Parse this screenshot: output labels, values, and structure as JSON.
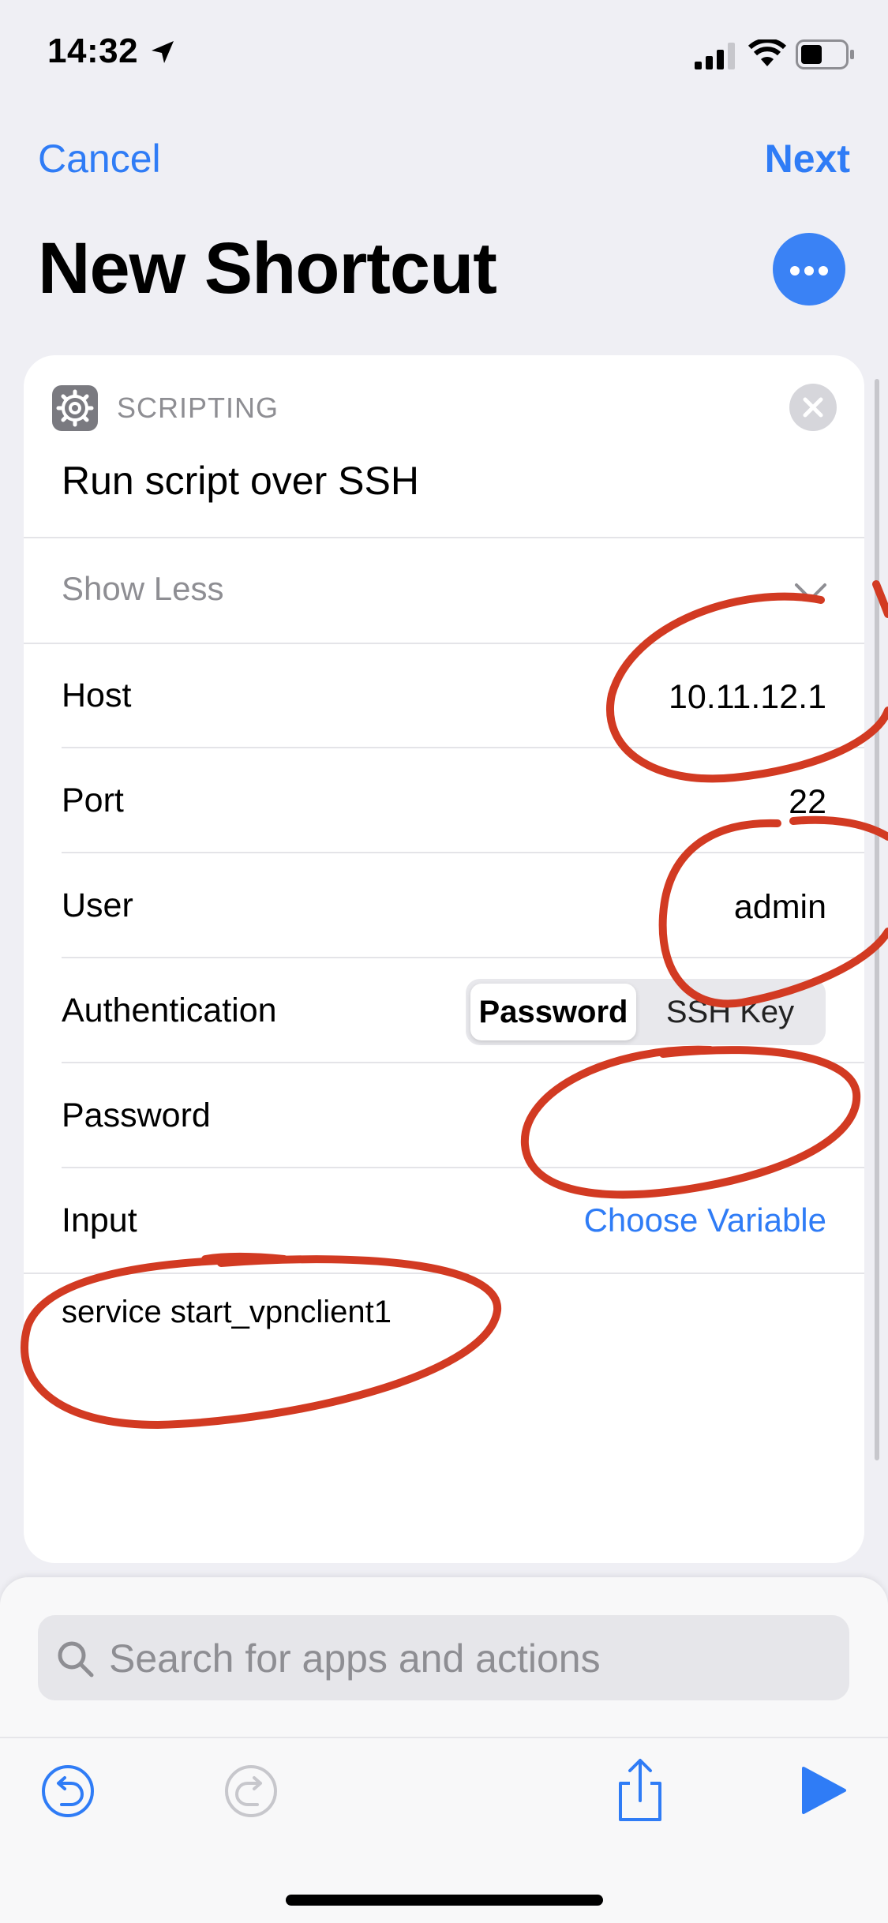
{
  "status_bar": {
    "time": "14:32"
  },
  "nav": {
    "cancel": "Cancel",
    "next": "Next",
    "title": "New Shortcut"
  },
  "card": {
    "category": "SCRIPTING",
    "action_title": "Run script over SSH",
    "show_less": "Show Less",
    "rows": [
      {
        "label": "Host",
        "value": "10.11.12.1"
      },
      {
        "label": "Port",
        "value": "22"
      },
      {
        "label": "User",
        "value": "admin"
      },
      {
        "label": "Authentication"
      },
      {
        "label": "Password",
        "value": ""
      },
      {
        "label": "Input",
        "value": "Choose Variable"
      }
    ],
    "auth_options": [
      "Password",
      "SSH Key"
    ],
    "auth_selected": "Password",
    "script": "service start_vpnclient1"
  },
  "bottom": {
    "search_placeholder": "Search for apps and actions"
  },
  "colors": {
    "accent": "#2f7cf6",
    "annotation": "#d23a22"
  }
}
